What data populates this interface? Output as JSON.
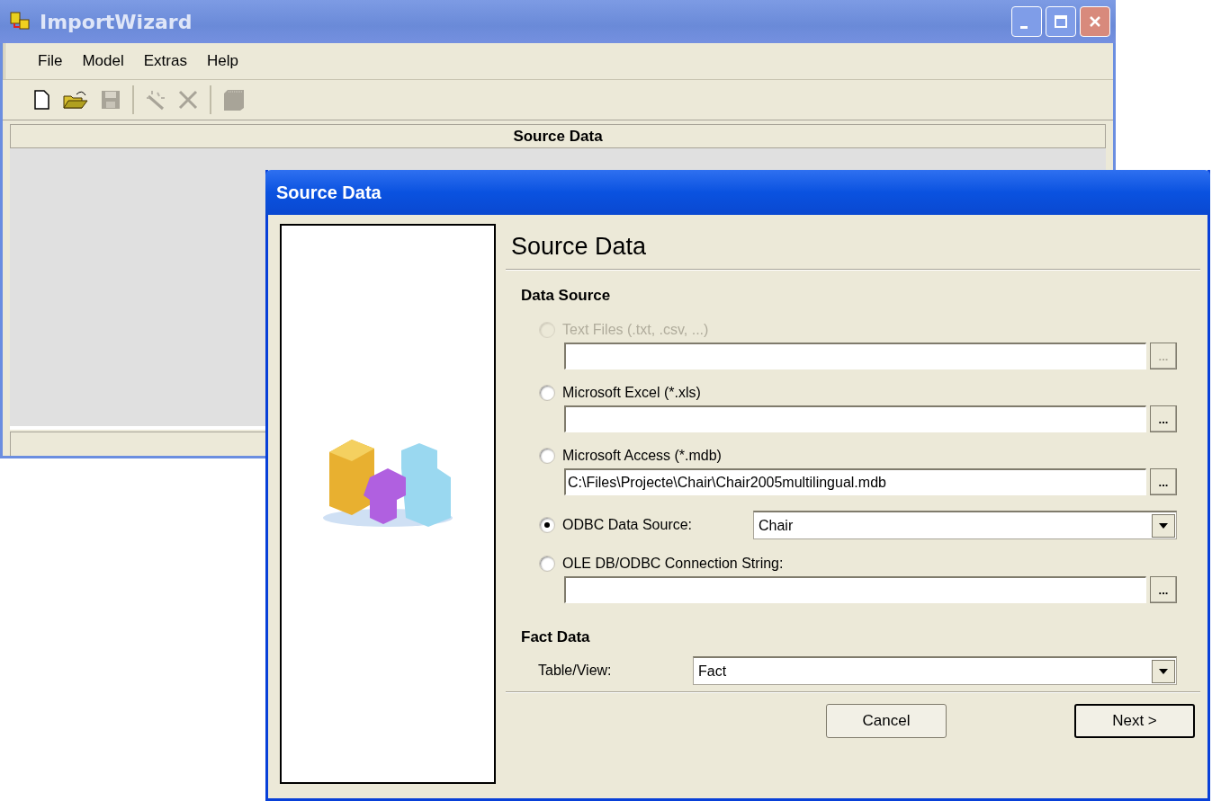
{
  "main_window": {
    "title": "ImportWizard",
    "menu": [
      "File",
      "Model",
      "Extras",
      "Help"
    ],
    "toolbar": [
      {
        "kind": "new",
        "disabled": false
      },
      {
        "kind": "open",
        "disabled": false
      },
      {
        "kind": "save",
        "disabled": true
      },
      {
        "kind": "sep"
      },
      {
        "kind": "wand",
        "disabled": true
      },
      {
        "kind": "delete",
        "disabled": true
      },
      {
        "kind": "sep"
      },
      {
        "kind": "book",
        "disabled": true
      }
    ],
    "panel_header": "Source Data"
  },
  "dialog": {
    "title": "Source Data",
    "heading": "Source Data",
    "section_1": "Data Source",
    "options": [
      {
        "kind": "path",
        "label": "Text Files (.txt, .csv, ...)",
        "disabled": true,
        "selected": false,
        "browse": "..."
      },
      {
        "kind": "path",
        "label": "Microsoft Excel (*.xls)",
        "disabled": false,
        "selected": false,
        "browse": "..."
      },
      {
        "kind": "path",
        "label": "Microsoft Access (*.mdb)",
        "disabled": false,
        "selected": false,
        "value": "C:\\Files\\Projecte\\Chair\\Chair2005multilingual.mdb",
        "browse": "..."
      },
      {
        "kind": "dropdown",
        "label": "ODBC Data Source:",
        "disabled": false,
        "selected": true,
        "value": "Chair"
      },
      {
        "kind": "path",
        "label": "OLE DB/ODBC Connection String:",
        "disabled": false,
        "selected": false,
        "browse": "..."
      }
    ],
    "section_2": "Fact Data",
    "table_view": {
      "label": "Table/View:",
      "value": "Fact"
    },
    "buttons": [
      {
        "label": "Cancel",
        "default": false
      },
      {
        "label": "Next >",
        "default": true
      }
    ]
  }
}
